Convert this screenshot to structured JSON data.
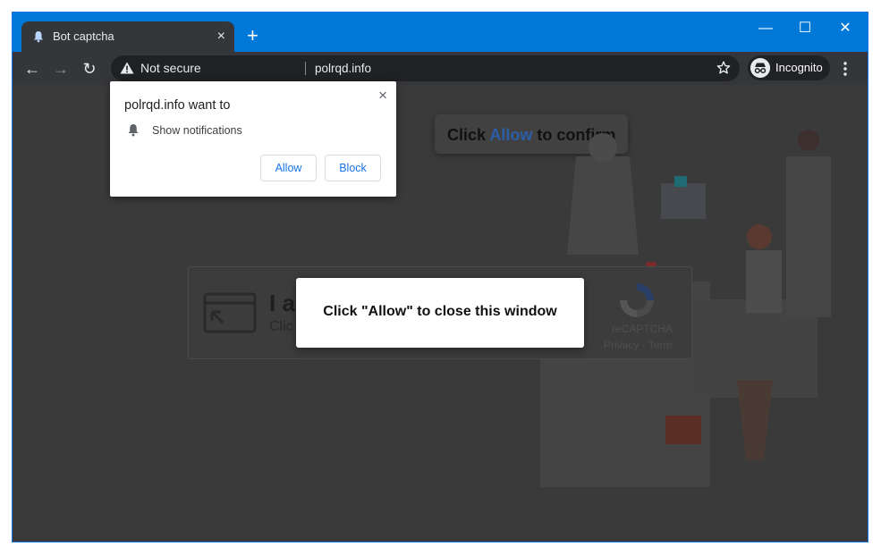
{
  "tab": {
    "title": "Bot captcha",
    "close": "×",
    "new_tab": "+"
  },
  "window_controls": {
    "minimize": "—",
    "maximize": "☐",
    "close": "✕"
  },
  "toolbar": {
    "back": "←",
    "forward": "→",
    "reload": "↻",
    "security_label": "Not secure",
    "url": "polrqd.info",
    "profile_label": "Incognito"
  },
  "permission_prompt": {
    "title": "polrqd.info want to",
    "item": "Show notifications",
    "allow_label": "Allow",
    "block_label": "Block",
    "close": "×"
  },
  "page": {
    "confirm_prefix": "Click ",
    "confirm_allow": "Allow",
    "confirm_suffix": " to confirm",
    "captcha_heading": "I a",
    "captcha_sub": "Clic",
    "recaptcha_label": "reCAPTCHA",
    "recaptcha_links": "Privacy - Term",
    "modal_text": "Click \"Allow\" to close this window"
  },
  "colors": {
    "titlebar": "#0078d7",
    "toolbar": "#35363a",
    "link_blue": "#1a73e8"
  }
}
